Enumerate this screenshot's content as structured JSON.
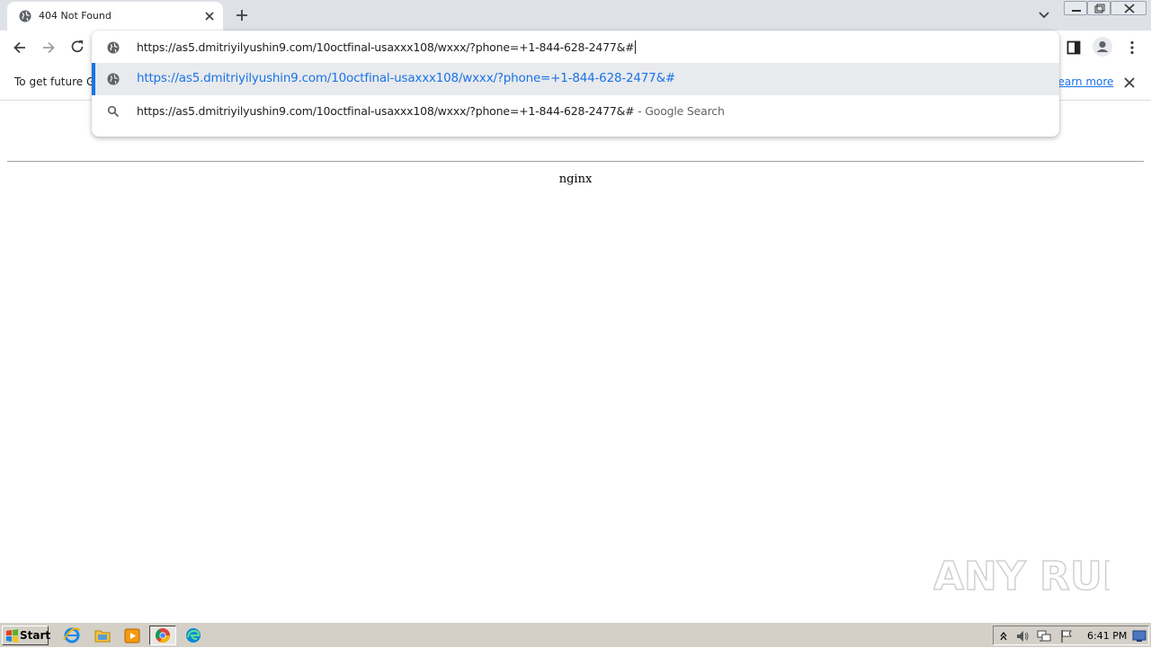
{
  "tab": {
    "title": "404 Not Found"
  },
  "omnibox": {
    "input_text": "https://as5.dmitriyilyushin9.com/10octfinal-usaxxx108/wxxx/?phone=+1-844-628-2477&#",
    "suggestions": [
      {
        "text": "https://as5.dmitriyilyushin9.com/10octfinal-usaxxx108/wxxx/?phone=+1-844-628-2477&#",
        "kind": "url"
      },
      {
        "text": "https://as5.dmitriyilyushin9.com/10octfinal-usaxxx108/wxxx/?phone=+1-844-628-2477&#",
        "suffix": " - Google Search",
        "kind": "search"
      }
    ]
  },
  "infobar": {
    "text": "To get future G",
    "link": "Learn more"
  },
  "page": {
    "server": "nginx"
  },
  "watermark": {
    "text": "ANY RUN"
  },
  "taskbar": {
    "start_label": "Start",
    "clock": "6:41 PM"
  },
  "colors": {
    "accent": "#1a73e8",
    "tabstrip": "#dee1e6",
    "taskbar": "#d4d0c8"
  },
  "icons": [
    "globe-icon",
    "close-icon",
    "plus-icon",
    "chevron-down-icon",
    "back-arrow-icon",
    "forward-arrow-icon",
    "reload-icon",
    "side-panel-icon",
    "profile-icon",
    "menu-dots-icon",
    "search-icon",
    "windows-flag-icon",
    "ie-icon",
    "folder-icon",
    "media-player-icon",
    "chrome-icon",
    "edge-icon"
  ]
}
